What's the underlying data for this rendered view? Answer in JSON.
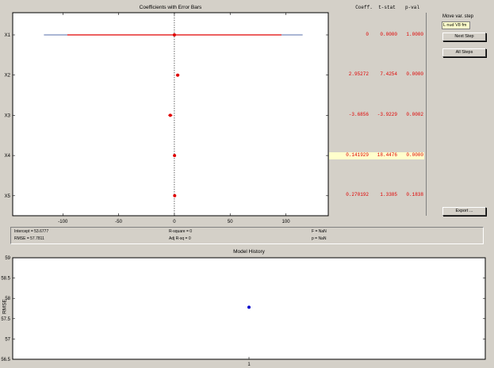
{
  "coefficients": {
    "title": "Coefficients with Error Bars",
    "headers": {
      "coeff": "Coeff.",
      "tstat": "t-stat",
      "pval": "p-val"
    },
    "rows": [
      {
        "label": "X1",
        "coeff": "0",
        "tstat": "0.0000",
        "pval": "1.0000",
        "highlight": false
      },
      {
        "label": "X2",
        "coeff": "2.95272",
        "tstat": "7.4254",
        "pval": "0.0000",
        "highlight": false
      },
      {
        "label": "X3",
        "coeff": "-3.6856",
        "tstat": "-3.9229",
        "pval": "0.0002",
        "highlight": false
      },
      {
        "label": "X4",
        "coeff": "0.141929",
        "tstat": "18.4476",
        "pval": "0.0000",
        "highlight": true
      },
      {
        "label": "X5",
        "coeff": "0.270192",
        "tstat": "1.3385",
        "pval": "0.1838",
        "highlight": false
      }
    ],
    "x_ticks": [
      "-100",
      "-50",
      "0",
      "50",
      "100"
    ],
    "xlim": [
      -145,
      138
    ]
  },
  "chart_data": {
    "type": "scatter",
    "title": "Coefficients with Error Bars",
    "categories": [
      "X1",
      "X2",
      "X3",
      "X4",
      "X5"
    ],
    "values": [
      0,
      2.95272,
      -3.6856,
      0.141929,
      0.270192
    ],
    "error_red": [
      [
        -96,
        96
      ],
      [
        1.4,
        4.5
      ],
      [
        -5.5,
        -1.8
      ],
      [
        0.13,
        0.155
      ],
      [
        -0.1,
        0.65
      ]
    ],
    "error_blue": [
      [
        -117,
        115
      ]
    ],
    "x_ticks": [
      -100,
      -50,
      0,
      50,
      100
    ],
    "xlim": [
      -145,
      138
    ],
    "xlabel": "",
    "ylabel": ""
  },
  "side_panel": {
    "label": "Move var. step",
    "input_value": "L nud V8 fm",
    "next_step": "Next Step",
    "all_steps": "All Steps",
    "export": "Export ..."
  },
  "stats": {
    "intercept": "Intercept = 53.6777",
    "rmse": "RMSE = 57.7811",
    "rsquare": "R-square = 0",
    "adj_rsq": "Adj R-sq = 0",
    "f": "F = NaN",
    "p": "p = NaN"
  },
  "history": {
    "title": "Model History",
    "ylabel": "RMSE",
    "y_ticks": [
      "59",
      "58.5",
      "58",
      "57.5",
      "57",
      "56.5"
    ],
    "ylim": [
      56.5,
      59
    ],
    "x_ticks": [
      "1"
    ],
    "point": {
      "x": 1,
      "y": 57.7811
    },
    "point_color": "#0000cc"
  },
  "colors": {
    "estimate": "#e00000",
    "ci": "#1c3c8c",
    "highlight": "#ffffcc"
  }
}
